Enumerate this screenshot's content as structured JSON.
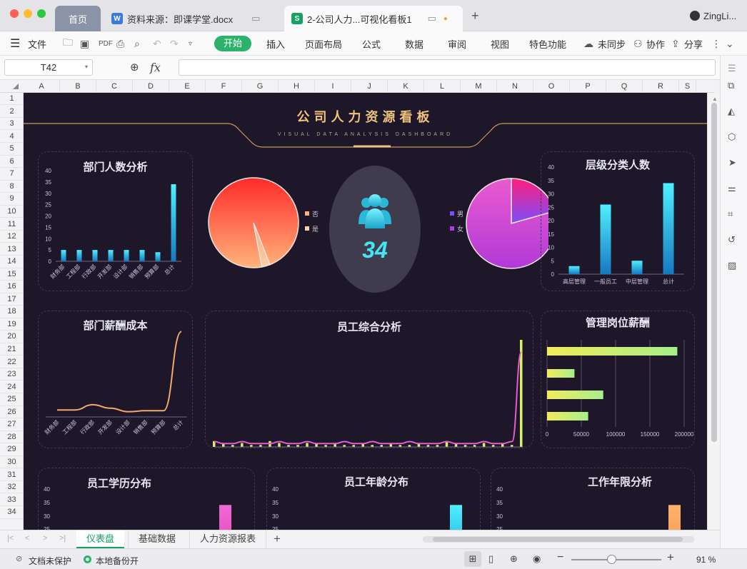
{
  "window": {
    "tabs": [
      {
        "label": "首页"
      },
      {
        "label": "资料来源：即课学堂.docx"
      },
      {
        "label": "2-公司人力...可视化看板1"
      }
    ],
    "user": "ZingLi..."
  },
  "ribbon": {
    "file_menu": "文件",
    "tabs": [
      "开始",
      "插入",
      "页面布局",
      "公式",
      "数据",
      "审阅",
      "视图",
      "特色功能"
    ],
    "sync": "未同步",
    "collab": "协作",
    "share": "分享"
  },
  "formula_bar": {
    "cell_ref": "T42",
    "fx": "fx",
    "value": ""
  },
  "grid": {
    "columns": [
      "A",
      "B",
      "C",
      "D",
      "E",
      "F",
      "G",
      "H",
      "I",
      "J",
      "K",
      "L",
      "M",
      "N",
      "O",
      "P",
      "Q",
      "R",
      "S"
    ],
    "rows": [
      "1",
      "2",
      "3",
      "4",
      "5",
      "6",
      "7",
      "8",
      "9",
      "10",
      "11",
      "12",
      "13",
      "14",
      "15",
      "16",
      "17",
      "18",
      "19",
      "20",
      "21",
      "22",
      "23",
      "24",
      "25",
      "26",
      "27",
      "28",
      "29",
      "30",
      "31",
      "32",
      "33",
      "34"
    ]
  },
  "dashboard": {
    "title": "公司人力资源看板",
    "subtitle": "VISUAL DATA ANALYSIS DASHBOARD",
    "headcount": "34",
    "colors": {
      "bg": "#1d1729",
      "cyan": "#3fe3f0",
      "gold": "#e6b86a",
      "pink": "#e23ca8",
      "orange": "#f4a86a"
    }
  },
  "chart_data": [
    {
      "type": "bar",
      "title": "部门人数分析",
      "categories": [
        "财务部",
        "工程部",
        "行政部",
        "开发部",
        "设计部",
        "销售部",
        "预算部",
        "总计"
      ],
      "values": [
        5,
        5,
        5,
        5,
        5,
        5,
        4,
        34
      ],
      "ylim": [
        0,
        40
      ],
      "yticks": [
        "0",
        "5",
        "10",
        "15",
        "20",
        "25",
        "30",
        "35",
        "40"
      ]
    },
    {
      "type": "pie",
      "title": "",
      "categories": [
        "否",
        "是"
      ],
      "values": [
        33,
        1
      ],
      "legend": "right"
    },
    {
      "type": "pie",
      "title": "",
      "categories": [
        "男",
        "女"
      ],
      "values": [
        7,
        27
      ],
      "legend": "left"
    },
    {
      "type": "bar",
      "title": "层级分类人数",
      "categories": [
        "高层管理",
        "一般员工",
        "中层管理",
        "总计"
      ],
      "values": [
        3,
        26,
        5,
        34
      ],
      "ylim": [
        0,
        40
      ],
      "yticks": [
        "0",
        "5",
        "10",
        "15",
        "20",
        "25",
        "30",
        "35",
        "40"
      ]
    },
    {
      "type": "line",
      "title": "部门薪酬成本",
      "categories": [
        "财务部",
        "工程部",
        "行政部",
        "开发部",
        "设计部",
        "销售部",
        "预算部",
        "总计"
      ],
      "values": [
        20,
        20,
        35,
        25,
        15,
        18,
        18,
        245
      ]
    },
    {
      "type": "line",
      "title": "员工综合分析",
      "series": [
        {
          "values": [
            3,
            2,
            1,
            2,
            1,
            1,
            3,
            2,
            1,
            1,
            2,
            2,
            1,
            2,
            1,
            1,
            2,
            1,
            1,
            2,
            1,
            1,
            2,
            1,
            1,
            3,
            2,
            1,
            1,
            2,
            1,
            2,
            1,
            55
          ]
        },
        {
          "values": [
            2,
            1,
            1,
            2,
            1,
            1,
            1,
            2,
            1,
            1,
            2,
            1,
            1,
            1,
            2,
            1,
            1,
            2,
            1,
            1,
            1,
            2,
            1,
            1,
            1,
            2,
            1,
            1,
            1,
            2,
            1,
            1,
            2,
            48
          ]
        }
      ]
    },
    {
      "type": "bar",
      "title": "管理岗位薪酬",
      "orientation": "horizontal",
      "values": [
        190000,
        40000,
        82000,
        60000
      ],
      "xlim": [
        0,
        200000
      ],
      "xticks": [
        "0",
        "50000",
        "100000",
        "150000",
        "200000"
      ]
    },
    {
      "type": "bar",
      "title": "员工学历分布",
      "yticks": [
        "25",
        "30",
        "35",
        "40"
      ],
      "values": [
        34
      ]
    },
    {
      "type": "bar",
      "title": "员工年龄分布",
      "yticks": [
        "25",
        "30",
        "35",
        "40"
      ],
      "values": [
        34
      ]
    },
    {
      "type": "bar",
      "title": "工作年限分析",
      "yticks": [
        "25",
        "30",
        "35",
        "40"
      ],
      "values": [
        34
      ]
    }
  ],
  "sheet_tabs": [
    "仪表盘",
    "基础数据",
    "人力资源报表"
  ],
  "status": {
    "protect": "文档未保护",
    "backup": "本地备份开",
    "zoom": "91 %"
  }
}
